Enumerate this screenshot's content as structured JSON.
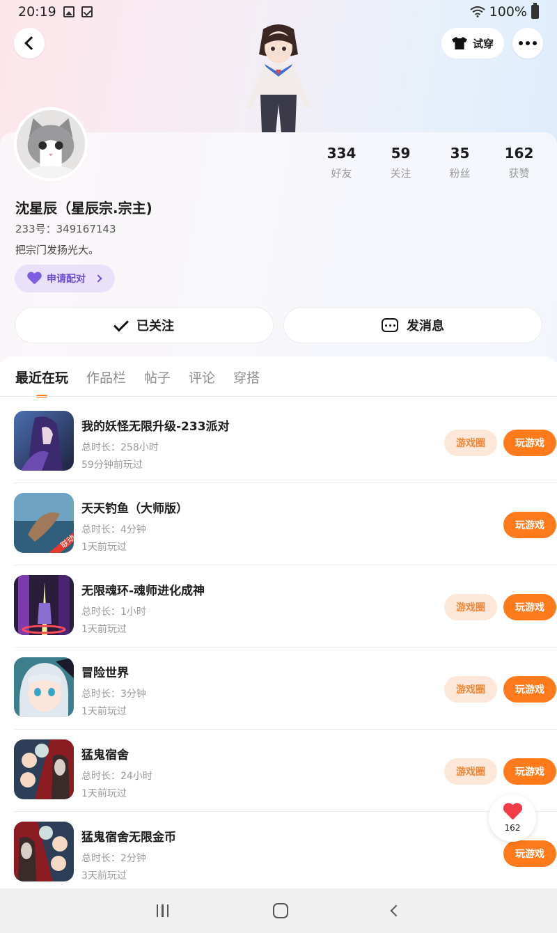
{
  "status_bar": {
    "time": "20:19",
    "battery": "100%"
  },
  "header": {
    "try_on_label": "试穿"
  },
  "profile": {
    "stats": [
      {
        "value": "334",
        "label": "好友"
      },
      {
        "value": "59",
        "label": "关注"
      },
      {
        "value": "35",
        "label": "粉丝"
      },
      {
        "value": "162",
        "label": "获赞"
      }
    ],
    "name": "沈星辰（星辰宗.宗主)",
    "id_text": "233号：349167143",
    "bio": "把宗门发扬光大。",
    "match_label": "申请配对",
    "follow_label": "已关注",
    "message_label": "发消息"
  },
  "tabs": [
    {
      "label": "最近在玩",
      "active": true
    },
    {
      "label": "作品栏",
      "active": false
    },
    {
      "label": "帖子",
      "active": false
    },
    {
      "label": "评论",
      "active": false
    },
    {
      "label": "穿搭",
      "active": false
    }
  ],
  "buttons": {
    "circle": "游戏圈",
    "play": "玩游戏"
  },
  "games": [
    {
      "name": "我的妖怪无限升级-233派对",
      "duration": "总时长：258小时",
      "last_played": "59分钟前玩过",
      "has_circle": true,
      "icon": "anime-warrior-icon"
    },
    {
      "name": "天天钓鱼（大师版）",
      "duration": "总时长：4分钟",
      "last_played": "1天前玩过",
      "has_circle": false,
      "icon": "fishing-icon",
      "badge": "联动"
    },
    {
      "name": "无限魂环-魂师进化成神",
      "duration": "总时长：1小时",
      "last_played": "1天前玩过",
      "has_circle": true,
      "icon": "soul-ring-icon"
    },
    {
      "name": "冒险世界",
      "duration": "总时长：3分钟",
      "last_played": "1天前玩过",
      "has_circle": true,
      "icon": "anime-girl-icon"
    },
    {
      "name": "猛鬼宿舍",
      "duration": "总时长：24小时",
      "last_played": "1天前玩过",
      "has_circle": true,
      "icon": "ghost-dorm-icon"
    },
    {
      "name": "猛鬼宿舍无限金币",
      "duration": "总时长：2分钟",
      "last_played": "3天前玩过",
      "has_circle": false,
      "icon": "ghost-dorm-icon"
    }
  ],
  "like_float": {
    "count": "162"
  },
  "colors": {
    "accent": "#ff7a1a",
    "accent_soft": "#fde7d8",
    "purple": "#7c5ce0",
    "red": "#f23b47"
  }
}
